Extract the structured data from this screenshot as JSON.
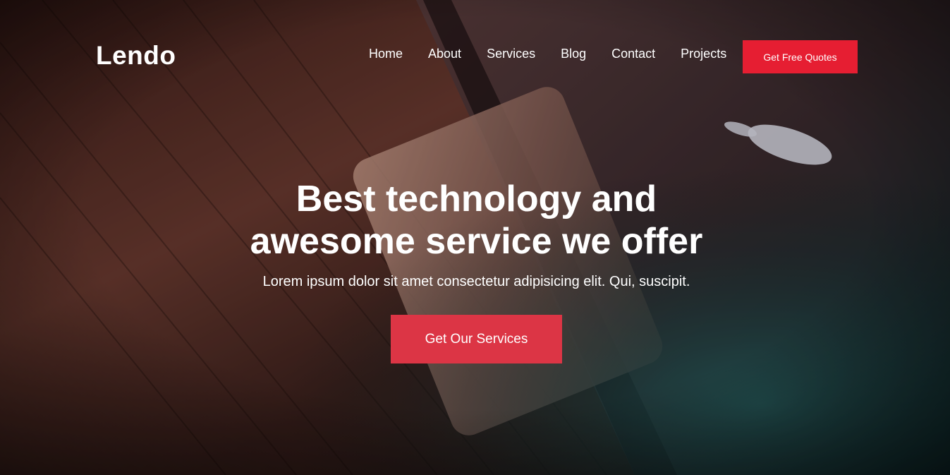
{
  "brand": {
    "name": "Lendo"
  },
  "nav": {
    "items": [
      {
        "label": "Home"
      },
      {
        "label": "About"
      },
      {
        "label": "Services"
      },
      {
        "label": "Blog"
      },
      {
        "label": "Contact"
      },
      {
        "label": "Projects"
      }
    ],
    "cta_label": "Get Free Quotes"
  },
  "hero": {
    "title_line1": "Best technology and",
    "title_line2": "awesome service we offer",
    "subtitle": "Lorem ipsum dolor sit amet consectetur adipisicing elit. Qui, suscipit.",
    "cta_label": "Get Our Services",
    "background_image": "laptop-on-wooden-desk-photo"
  },
  "colors": {
    "accent": "#e61e32",
    "cta": "#dc3545",
    "text": "#ffffff"
  }
}
